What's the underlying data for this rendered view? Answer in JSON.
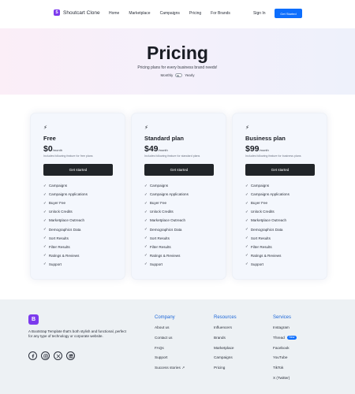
{
  "navbar": {
    "brand_name": "Shoutcart Clone",
    "links": [
      "Home",
      "Marketplace",
      "Campaigns",
      "Pricing",
      "For Brands"
    ],
    "signin_label": "Sign In",
    "getstarted_label": "Get Started"
  },
  "hero": {
    "title": "Pricing",
    "subtitle": "Pricing plans for every business brand needs!",
    "toggle_left": "Monthly",
    "toggle_right": "Yearly"
  },
  "plans": [
    {
      "name": "Free",
      "price": "$0",
      "period": "/month",
      "description": "Includes following feature for free plans",
      "button_label": "Get started",
      "features": [
        "Campaigns",
        "Campaigns Applications",
        "Buyer Fee",
        "Unlock Credits",
        "Marketplace Outreach",
        "Demographics Data",
        "Sort Results",
        "Filter Results",
        "Ratings & Reviews",
        "Support"
      ]
    },
    {
      "name": "Standard plan",
      "price": "$49",
      "period": "/month",
      "description": "Includes following feature for standard plans",
      "button_label": "Get started",
      "features": [
        "Campaigns",
        "Campaigns Applications",
        "Buyer Fee",
        "Unlock Credits",
        "Marketplace Outreach",
        "Demographics Data",
        "Sort Results",
        "Filter Results",
        "Ratings & Reviews",
        "Support"
      ]
    },
    {
      "name": "Business plan",
      "price": "$99",
      "period": "/month",
      "description": "Includes following feature for business plans",
      "button_label": "Get started",
      "features": [
        "Campaigns",
        "Campaigns Applications",
        "Buyer Fee",
        "Unlock Credits",
        "Marketplace Outreach",
        "Demographics Data",
        "Sort Results",
        "Filter Results",
        "Ratings & Reviews",
        "Support"
      ]
    }
  ],
  "footer": {
    "logo_letter": "B",
    "description": "A Bootstrap Template that's both stylish and functional, perfect for any type of technology or corporate website.",
    "socials": [
      "facebook-icon",
      "instagram-icon",
      "x-icon",
      "linkedin-icon"
    ],
    "columns": [
      {
        "title": "Company",
        "links": [
          "About us",
          "Contact us",
          "FAQs",
          "Support",
          "Success stories"
        ]
      },
      {
        "title": "Resources",
        "links": [
          "Influencers",
          "Brands",
          "Marketplace",
          "Campaigns",
          "Pricing"
        ]
      },
      {
        "title": "Services",
        "links": [
          "Instagram",
          "Thread",
          "Facebook",
          "YouTube",
          "TikTok",
          "X (Twitter)"
        ]
      }
    ],
    "new_badge": "New"
  },
  "colors": {
    "primary": "#0d6efd",
    "brand": "#7c3aed",
    "dark_button": "#212529",
    "footer_heading": "#1d67d8"
  }
}
